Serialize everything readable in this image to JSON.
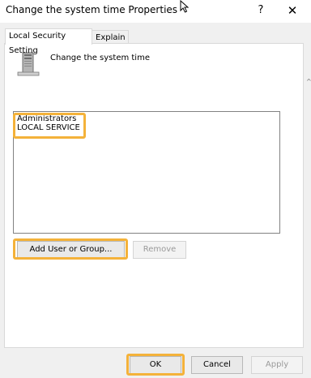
{
  "window": {
    "title": "Change the system time Properties",
    "help_label": "?",
    "close_label": "✕"
  },
  "tabs": [
    {
      "label": "Local Security Setting",
      "selected": true
    },
    {
      "label": "Explain",
      "selected": false
    }
  ],
  "policy": {
    "name": "Change the system time",
    "icon": "server-icon"
  },
  "members": [
    "Administrators",
    "LOCAL SERVICE"
  ],
  "buttons": {
    "add": "Add User or Group...",
    "remove": "Remove",
    "ok": "OK",
    "cancel": "Cancel",
    "apply": "Apply"
  },
  "colors": {
    "highlight": "#f4b23a"
  }
}
